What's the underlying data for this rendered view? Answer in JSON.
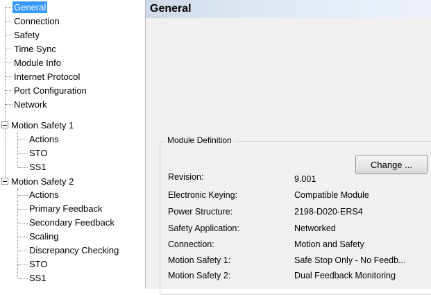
{
  "tree": {
    "items": [
      {
        "label": "General",
        "selected": true
      },
      {
        "label": "Connection"
      },
      {
        "label": "Safety"
      },
      {
        "label": "Time Sync"
      },
      {
        "label": "Module Info"
      },
      {
        "label": "Internet Protocol"
      },
      {
        "label": "Port Configuration"
      },
      {
        "label": "Network"
      },
      {
        "label": "Motion Safety 1",
        "expanded": true
      },
      {
        "label": "Actions"
      },
      {
        "label": "STO"
      },
      {
        "label": "SS1"
      },
      {
        "label": "Motion Safety 2",
        "expanded": true
      },
      {
        "label": "Actions"
      },
      {
        "label": "Primary Feedback"
      },
      {
        "label": "Secondary Feedback"
      },
      {
        "label": "Scaling"
      },
      {
        "label": "Discrepancy Checking"
      },
      {
        "label": "STO"
      },
      {
        "label": "SS1"
      }
    ]
  },
  "pane": {
    "title": "General",
    "group_title": "Module Definition",
    "change_label": "Change ...",
    "fields": [
      {
        "label": "Revision:",
        "value": "9.001"
      },
      {
        "label": "Electronic Keying:",
        "value": "Compatible Module"
      },
      {
        "label": "Power Structure:",
        "value": "2198-D020-ERS4"
      },
      {
        "label": "Safety Application:",
        "value": "Networked"
      },
      {
        "label": "Connection:",
        "value": "Motion and Safety"
      },
      {
        "label": "Motion Safety 1:",
        "value": "Safe Stop Only - No Feedb..."
      },
      {
        "label": "Motion Safety 2:",
        "value": "Dual Feedback Monitoring"
      }
    ]
  },
  "colors": {
    "selection": "#3399ff",
    "header_gradient_start": "#cfd9e8"
  }
}
